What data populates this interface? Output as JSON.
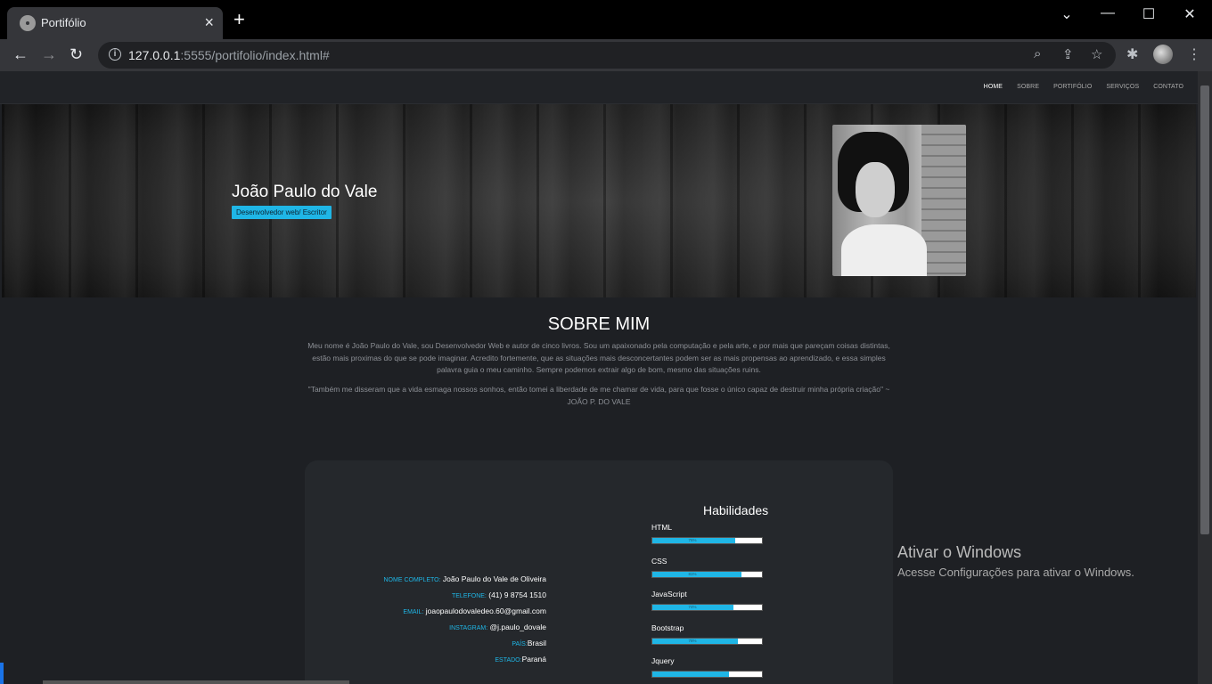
{
  "browser": {
    "tab_title": "Portifólio",
    "url_host": "127.0.0.1",
    "url_rest": ":5555/portifolio/index.html#"
  },
  "nav": {
    "items": [
      "HOME",
      "SOBRE",
      "PORTIFÓLIO",
      "SERVIÇOS",
      "CONTATO"
    ],
    "active": "HOME"
  },
  "hero": {
    "name": "João Paulo do Vale",
    "role": "Desenvolvedor web/ Escritor"
  },
  "about": {
    "title": "SOBRE MIM",
    "text": "Meu nome é João Paulo do Vale, sou Desenvolvedor Web e autor de cinco livros. Sou um apaixonado pela computação e pela arte, e por mais que pareçam coisas distintas, estão mais proximas do que se pode imaginar. Acredito fortemente, que as situações mais desconcertantes podem ser as mais propensas ao aprendizado, e essa simples palavra guia o meu caminho. Sempre podemos extrair algo de bom, mesmo das situações ruins.",
    "quote": "\"Também me disseram que a vida esmaga nossos sonhos, então tomei a liberdade de me chamar de vida, para que fosse o único capaz de destruir minha própria criação\" ~ JOÃO P. DO VALE"
  },
  "info": [
    {
      "label": "NOME COMPLETO:",
      "value": " João Paulo do Vale de Oliveira"
    },
    {
      "label": "TELEFONE:",
      "value": " (41) 9 8754 1510"
    },
    {
      "label": "EMAIL:",
      "value": " joaopaulodovaledeo.60@gmail.com"
    },
    {
      "label": "INSTAGRAM:",
      "value": " @j.paulo_dovale"
    },
    {
      "label": "PAÍS:",
      "value": "Brasil"
    },
    {
      "label": "ESTADO:",
      "value": "Paraná"
    }
  ],
  "skills": {
    "title": "Habilidades",
    "items": [
      {
        "name": "HTML",
        "percent": 76,
        "label": "76%"
      },
      {
        "name": "CSS",
        "percent": 81,
        "label": "81%"
      },
      {
        "name": "JavaScript",
        "percent": 74,
        "label": "74%"
      },
      {
        "name": "Bootstrap",
        "percent": 78,
        "label": "78%"
      },
      {
        "name": "Jquery",
        "percent": 70,
        "label": ""
      }
    ]
  },
  "windows_activation": {
    "title": "Ativar o Windows",
    "subtitle": "Acesse Configurações para ativar o Windows."
  },
  "colors": {
    "accent": "#1fb6e6",
    "background": "#1e2024",
    "card": "#25282c"
  }
}
